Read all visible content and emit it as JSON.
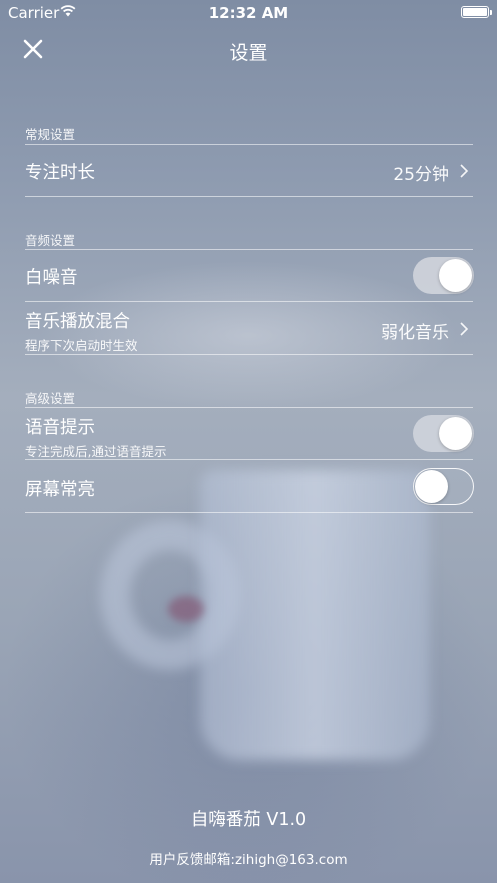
{
  "status_bar": {
    "carrier": "Carrier",
    "time": "12:32 AM",
    "icons": [
      "wifi-icon",
      "battery-icon"
    ]
  },
  "navbar": {
    "title": "设置",
    "close_icon": "close-icon"
  },
  "sections": [
    {
      "header": "常规设置",
      "rows": [
        {
          "label": "专注时长",
          "value": "25分钟",
          "accessory": "chevron-right-icon"
        }
      ]
    },
    {
      "header": "音频设置",
      "rows": [
        {
          "label": "白噪音",
          "toggle_on": true
        },
        {
          "label": "音乐播放混合",
          "subtitle": "程序下次启动时生效",
          "value": "弱化音乐",
          "accessory": "chevron-right-icon"
        }
      ]
    },
    {
      "header": "高级设置",
      "rows": [
        {
          "label": "语音提示",
          "subtitle": "专注完成后,通过语音提示",
          "toggle_on": true
        },
        {
          "label": "屏幕常亮",
          "toggle_on": false
        }
      ]
    }
  ],
  "footer": {
    "version": "自嗨番茄 V1.0",
    "feedback": "用户反馈邮箱:zihigh@163.com"
  },
  "colors": {
    "text": "#ffffff",
    "toggle_on_track": "#cdd2da",
    "background": "#9ba6b4"
  }
}
